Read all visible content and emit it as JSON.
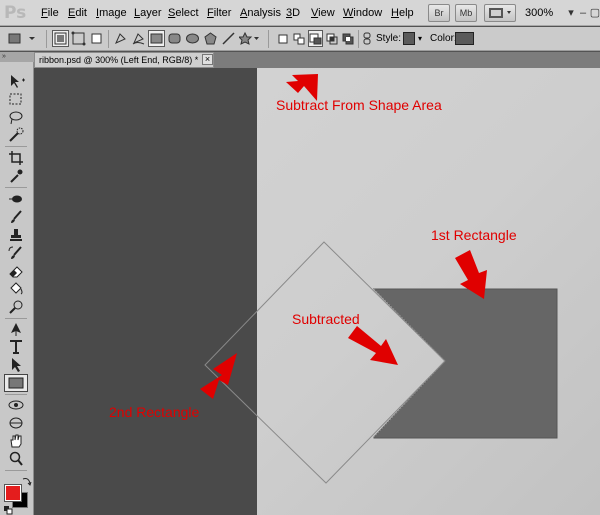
{
  "app": {
    "logo": "Ps"
  },
  "menu": {
    "items": [
      "File",
      "Edit",
      "Image",
      "Layer",
      "Select",
      "Filter",
      "Analysis",
      "3D",
      "View",
      "Window",
      "Help"
    ],
    "bridge_label": "Br",
    "minibridge_label": "Mb",
    "zoom": "300%"
  },
  "options": {
    "style_label": "Style:",
    "color_label": "Color:",
    "style_swatch_color": "#5a5a5a",
    "shape_color": "#5a5a5a"
  },
  "document": {
    "tab_title": "ribbon.psd @ 300% (Left End, RGB/8) *",
    "close_glyph": "×"
  },
  "colors": {
    "foreground": "#e41d1d",
    "background": "#000000",
    "annotation": "#e00000",
    "shape_fill": "#666666"
  },
  "annotations": {
    "subtract_label": "Subtract From Shape Area",
    "first_rect_label": "1st Rectangle",
    "subtracted_label": "Subtracted",
    "second_rect_label": "2nd Rectangle"
  }
}
